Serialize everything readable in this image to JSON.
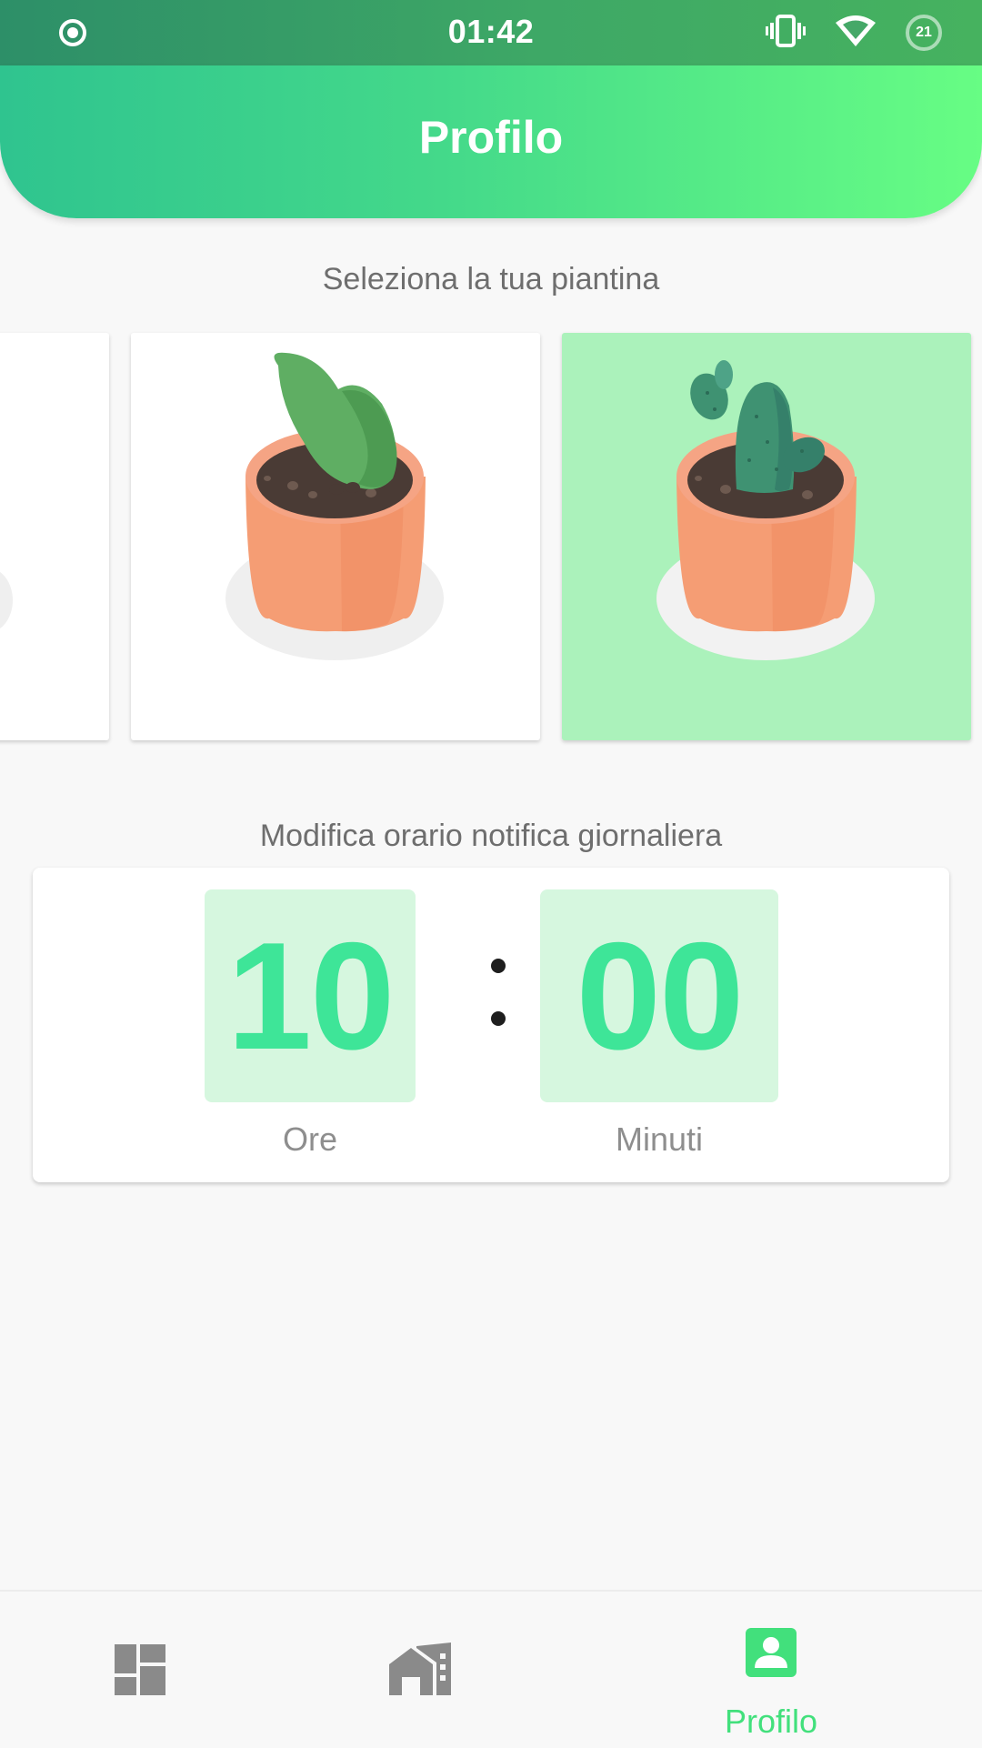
{
  "status_bar": {
    "time": "01:42",
    "battery_level": "21",
    "icons": [
      "recording-icon",
      "vibrate-icon",
      "wifi-icon",
      "battery-icon"
    ]
  },
  "header": {
    "title": "Profilo"
  },
  "plant_section": {
    "label": "Seleziona la tua piantina",
    "plants": [
      {
        "name": "partial-plant",
        "selected": false
      },
      {
        "name": "green-oval-plant",
        "selected": false
      },
      {
        "name": "cactus-plant",
        "selected": true
      }
    ]
  },
  "notification_section": {
    "label": "Modifica orario notifica giornaliera",
    "hours": "10",
    "minutes": "00",
    "hours_caption": "Ore",
    "minutes_caption": "Minuti"
  },
  "bottom_nav": {
    "items": [
      {
        "icon": "dashboard-icon",
        "label": ""
      },
      {
        "icon": "home-icon",
        "label": ""
      },
      {
        "icon": "profile-icon",
        "label": "Profilo",
        "active": true
      }
    ]
  },
  "colors": {
    "accent": "#42e07c",
    "digits": "#3ee598",
    "digit_box": "#d6f7df",
    "selected_card": "#abf2bb",
    "nav_inactive": "#8a8a8a"
  }
}
